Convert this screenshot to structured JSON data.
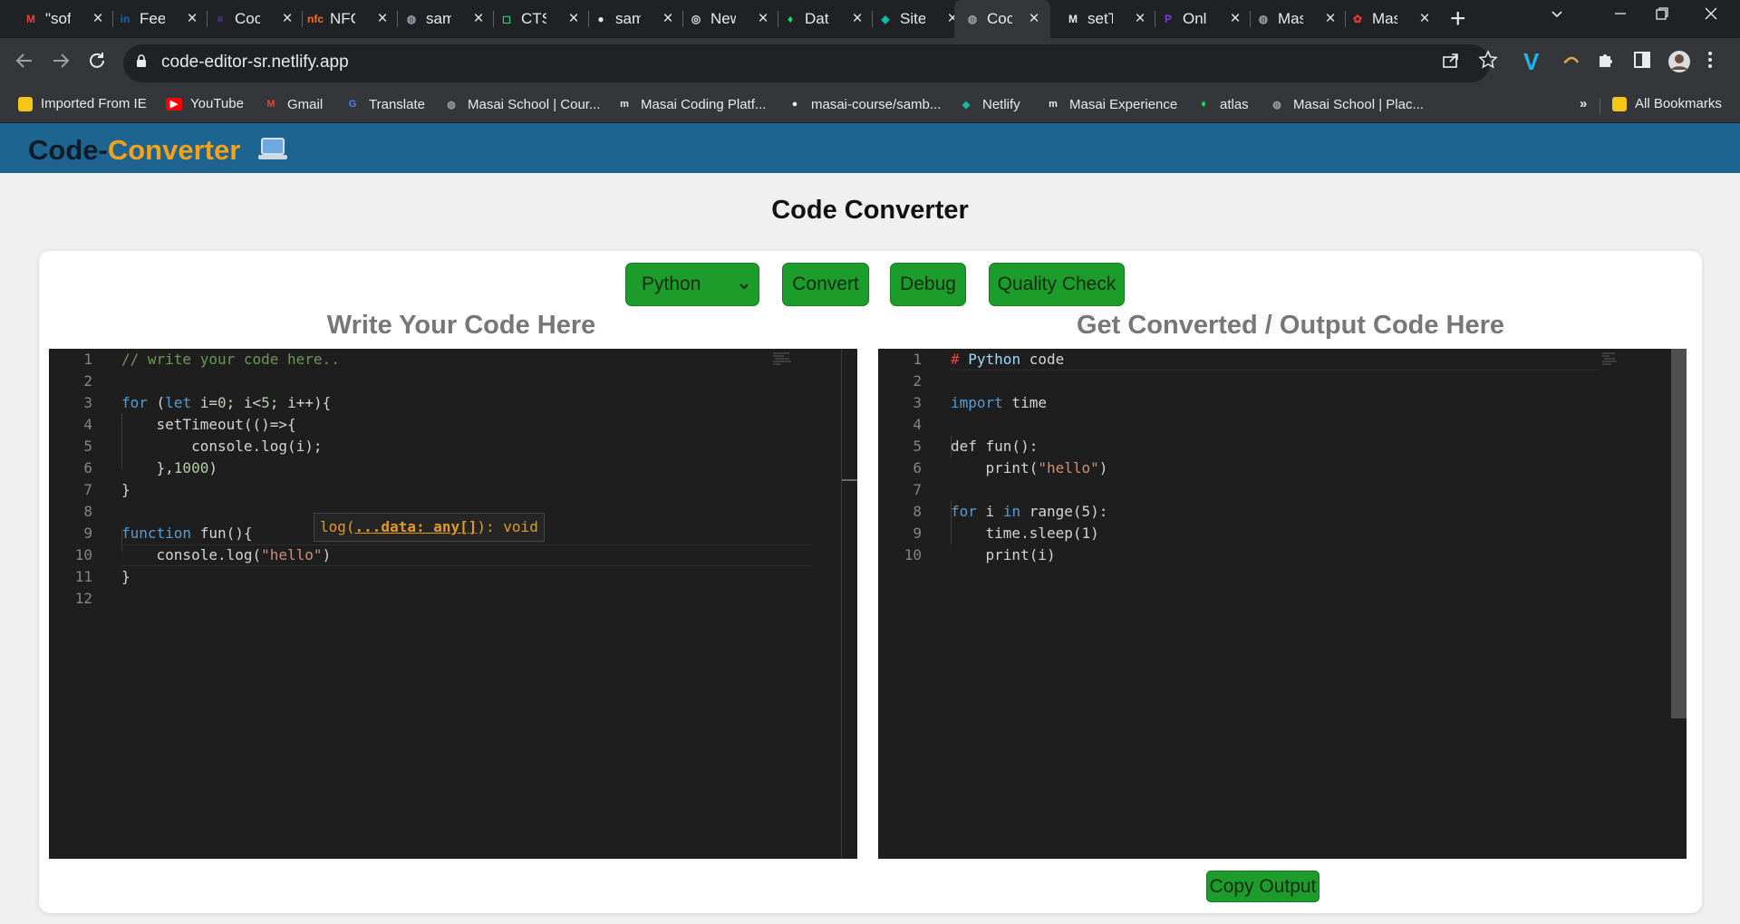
{
  "browser": {
    "tabs": [
      {
        "label": "\"sof",
        "icon": "gmail-icon",
        "color": "#ea4335"
      },
      {
        "label": "Fee",
        "icon": "linkedin-icon",
        "color": "#0a66c2"
      },
      {
        "label": "Coc",
        "icon": "forms-icon",
        "color": "#673ab7"
      },
      {
        "label": "NFC",
        "icon": "nfc-icon",
        "color": "#f36f21"
      },
      {
        "label": "sam",
        "icon": "globe-icon",
        "color": "#9aa0a6"
      },
      {
        "label": "CTS",
        "icon": "replit-icon",
        "color": "#1fd67a"
      },
      {
        "label": "sam",
        "icon": "github-icon",
        "color": "#e8eaed"
      },
      {
        "label": "New",
        "icon": "chrome-icon",
        "color": "#e8eaed"
      },
      {
        "label": "Dat",
        "icon": "mongodb-icon",
        "color": "#00ed64"
      },
      {
        "label": "Site",
        "icon": "netlify-icon",
        "color": "#14b8a6"
      },
      {
        "label": "Coc",
        "icon": "globe-icon",
        "color": "#9aa0a6"
      },
      {
        "label": "setT",
        "icon": "medium-icon",
        "color": "#e8eaed"
      },
      {
        "label": "Onl",
        "icon": "compiler-icon",
        "color": "#7c3aed"
      },
      {
        "label": "Mas",
        "icon": "globe-icon",
        "color": "#9aa0a6"
      },
      {
        "label": "Mas",
        "icon": "masai-icon",
        "color": "#e63a3a"
      }
    ],
    "active_tab_index": 10,
    "url": "code-editor-sr.netlify.app",
    "bookmarks": [
      {
        "label": "Imported From IE",
        "icon": "folder-icon",
        "color": "#f5c518"
      },
      {
        "label": "YouTube",
        "icon": "youtube-icon",
        "color": "#ff0000"
      },
      {
        "label": "Gmail",
        "icon": "gmail-icon",
        "color": "#ea4335"
      },
      {
        "label": "Translate",
        "icon": "translate-icon",
        "color": "#4285f4"
      },
      {
        "label": "Masai School | Cour...",
        "icon": "globe-icon",
        "color": "#9aa0a6"
      },
      {
        "label": "Masai Coding Platf...",
        "icon": "masai-m-icon",
        "color": "#e8eaed"
      },
      {
        "label": "masai-course/samb...",
        "icon": "github-icon",
        "color": "#e8eaed"
      },
      {
        "label": "Netlify",
        "icon": "netlify-icon",
        "color": "#14b8a6"
      },
      {
        "label": "Masai Experience",
        "icon": "masai-m-icon",
        "color": "#e8eaed"
      },
      {
        "label": "atlas",
        "icon": "mongodb-icon",
        "color": "#00ed64"
      },
      {
        "label": "Masai School | Plac...",
        "icon": "globe-icon",
        "color": "#9aa0a6"
      }
    ],
    "overflow_chevron": "»",
    "all_bookmarks": "All Bookmarks"
  },
  "app": {
    "brand_part1": "Code-",
    "brand_part2": "Converter",
    "title": "Code Converter",
    "controls": {
      "language_selected": "Python",
      "convert_label": "Convert",
      "debug_label": "Debug",
      "quality_label": "Quality Check"
    },
    "input_heading": "Write Your Code Here",
    "output_heading": "Get Converted / Output Code Here",
    "copy_label": "Copy Output",
    "colors": {
      "appbar": "#1d6490",
      "brand_accent": "#f4a21c",
      "button_green": "#1c9c2a"
    }
  },
  "input_editor": {
    "line_numbers": [
      "1",
      "2",
      "3",
      "4",
      "5",
      "6",
      "7",
      "8",
      "9",
      "10",
      "11",
      "12"
    ],
    "lines": [
      [
        {
          "t": "// write your code here..",
          "c": "cm"
        }
      ],
      [],
      [
        {
          "t": "for",
          "c": "kw"
        },
        {
          "t": " ("
        },
        {
          "t": "let",
          "c": "kw"
        },
        {
          "t": " i="
        },
        {
          "t": "0",
          "c": "num"
        },
        {
          "t": "; i<"
        },
        {
          "t": "5",
          "c": "num"
        },
        {
          "t": "; i++){"
        }
      ],
      [
        {
          "t": "    setTimeout(()=>{"
        }
      ],
      [
        {
          "t": "        console.log(i);"
        }
      ],
      [
        {
          "t": "    },"
        },
        {
          "t": "1000",
          "c": "num"
        },
        {
          "t": ")"
        }
      ],
      [
        {
          "t": "}"
        }
      ],
      [],
      [
        {
          "t": "function",
          "c": "kw"
        },
        {
          "t": " fun(){"
        }
      ],
      [
        {
          "t": "    console.log("
        },
        {
          "t": "\"hello\"",
          "c": "str"
        },
        {
          "t": ")"
        }
      ],
      [
        {
          "t": "}"
        }
      ],
      []
    ],
    "tooltip": {
      "prefix": "log(",
      "param": "...data: any[]",
      "suffix": "): void"
    }
  },
  "output_editor": {
    "line_numbers": [
      "1",
      "2",
      "3",
      "4",
      "5",
      "6",
      "7",
      "8",
      "9",
      "10"
    ],
    "lines": [
      [
        {
          "t": "#",
          "c": "cmr"
        },
        {
          "t": " Python",
          "c": "cm2"
        },
        {
          "t": " code"
        }
      ],
      [],
      [
        {
          "t": "import",
          "c": "kw"
        },
        {
          "t": " time"
        }
      ],
      [],
      [
        {
          "t": "def fun():"
        }
      ],
      [
        {
          "t": "    print("
        },
        {
          "t": "\"hello\"",
          "c": "str"
        },
        {
          "t": ")"
        }
      ],
      [],
      [
        {
          "t": "for",
          "c": "kw"
        },
        {
          "t": " i "
        },
        {
          "t": "in",
          "c": "kw"
        },
        {
          "t": " range(5):"
        }
      ],
      [
        {
          "t": "    time.sleep(1)"
        }
      ],
      [
        {
          "t": "    print(i)"
        }
      ]
    ]
  }
}
